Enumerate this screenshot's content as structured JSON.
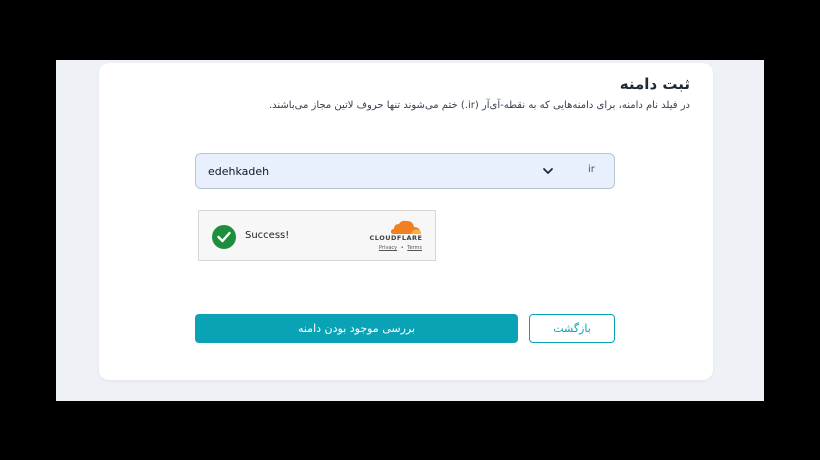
{
  "page": {
    "title": "ثبت دامنه",
    "description": "در فیلد نام دامنه، برای دامنه‌هایی که به نقطه-آی‌آر (ir.) ختم می‌شوند تنها حروف لاتین مجاز می‌باشند."
  },
  "domain": {
    "value": "edehkadeh",
    "tld": "ir"
  },
  "captcha": {
    "status": "Success!",
    "brand": "CLOUDFLARE",
    "privacy": "Privacy",
    "separator": "•",
    "terms": "Terms",
    "check_color": "#1e8e3e",
    "brand_color": "#f38020"
  },
  "actions": {
    "check_label": "بررسی موجود بودن دامنه",
    "back_label": "بازگشت",
    "accent": "#0aa3b5"
  },
  "icons": {
    "dropdown": "chevron-down-icon",
    "check": "check-icon",
    "cloud": "cloudflare-cloud-icon"
  }
}
